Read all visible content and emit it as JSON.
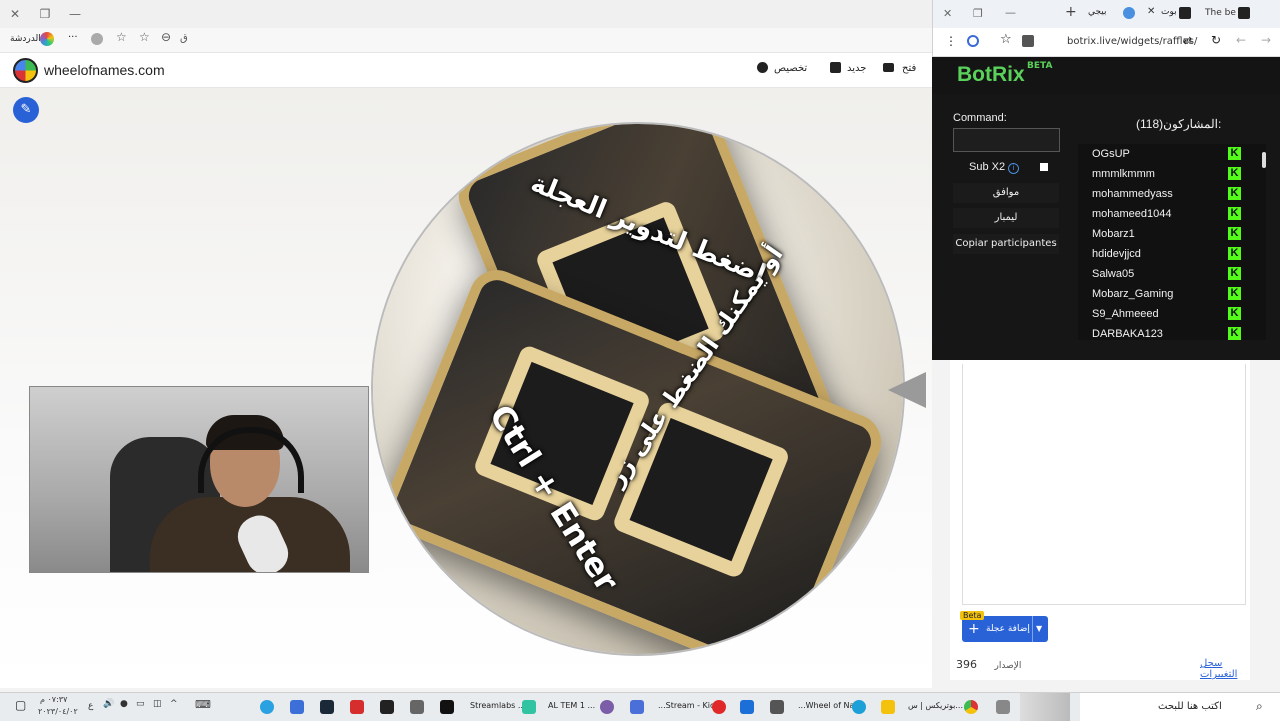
{
  "main_window": {
    "toolbar": {
      "profile_label": "الدردشة",
      "more": "···",
      "translate_label": "ق"
    }
  },
  "wheel_site": {
    "site_name": "wheelofnames.com",
    "menu": {
      "customize": "تخصيص",
      "new": "جديد",
      "open": "فتح"
    },
    "wheel_texts": {
      "line1": "اضغط لتدوير العجلة",
      "line2": "أو يمكنك الضغط على زر",
      "line3": "Ctrl + Enter"
    },
    "add_wheel_label": "إضافة عجلة",
    "beta_badge": "Beta",
    "version_label": "الإصدار",
    "version_number": "396",
    "changelog_link": "سجل التغييرات"
  },
  "botrix_window": {
    "tabs": [
      {
        "label": "بوت"
      },
      {
        "label": "بيجي"
      },
      {
        "label": "The be"
      }
    ],
    "url": "botrix.live/widgets/raffles/",
    "logo": "BotRix",
    "logo_badge": "BETA",
    "command_label": "Command:",
    "sub_x2_label": "Sub X2",
    "accept_button": "موافق",
    "reset_button": "ليمبار",
    "copy_button": "Copiar participantes",
    "participants_title": "المشاركون(118):",
    "participants": [
      "OGsUP",
      "mmmlkmmm",
      "mohammedyass",
      "mohameed1044",
      "Mobarz1",
      "hdidevjjcd",
      "Salwa05",
      "Mobarz_Gaming",
      "S9_Ahmeeed",
      "DARBAKA123"
    ]
  },
  "taskbar": {
    "search_placeholder": "اكتب هنا للبحث",
    "items": [
      {
        "label": "بوتريكس | س..."
      },
      {
        "label": "...Wheel of Na"
      },
      {
        "label": "...Stream - Kic"
      },
      {
        "label": "AL TEM 1 ..."
      },
      {
        "label": "Streamlabs ..."
      }
    ],
    "clock_time": "٠٧:٣٧ م",
    "clock_date": "٢٠٢٣/٠٤/٠٢",
    "lang": "ع"
  },
  "colors": {
    "accent_blue": "#2962d7",
    "botrix_green": "#5ad15a",
    "kick_green": "#53fc18"
  }
}
